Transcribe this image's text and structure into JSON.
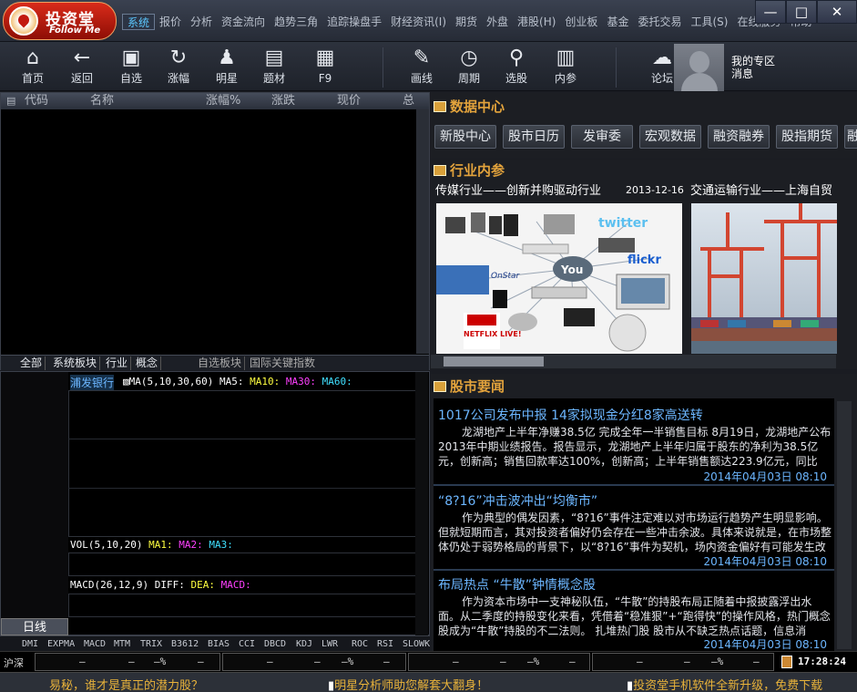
{
  "app": {
    "logo_title": "投资堂",
    "logo_sub": "Follow Me"
  },
  "menus": [
    "系统",
    "报价",
    "分析",
    "资金流向",
    "趋势三角",
    "追踪操盘手",
    "财经资讯(I)",
    "期货",
    "外盘",
    "港股(H)",
    "创业板",
    "基金",
    "委托交易",
    "工具(S)",
    "在线服务",
    "帮助"
  ],
  "window": {
    "minimize": "—",
    "maximize": "□",
    "close": "✕"
  },
  "toolbar": [
    {
      "label": "首页",
      "icon": "home-icon",
      "glyph": "⌂"
    },
    {
      "label": "返回",
      "icon": "back-arrow-icon",
      "glyph": "←"
    },
    {
      "label": "自选",
      "icon": "briefcase-icon",
      "glyph": "▣"
    },
    {
      "label": "涨幅",
      "icon": "refresh-icon",
      "glyph": "↻"
    },
    {
      "label": "明星",
      "icon": "person-icon",
      "glyph": "♟"
    },
    {
      "label": "题材",
      "icon": "stack-icon",
      "glyph": "▤"
    },
    {
      "label": "F9",
      "icon": "table-icon",
      "glyph": "▦"
    },
    {
      "label": "画线",
      "icon": "pencil-icon",
      "glyph": "✎"
    },
    {
      "label": "周期",
      "icon": "clock-icon",
      "glyph": "◷"
    },
    {
      "label": "选股",
      "icon": "search-icon",
      "glyph": "⚲"
    },
    {
      "label": "内参",
      "icon": "document-icon",
      "glyph": "▥"
    },
    {
      "label": "论坛",
      "icon": "chat-icon",
      "glyph": "☁"
    }
  ],
  "user_zone": {
    "line1": "我的专区",
    "line2": "消息"
  },
  "stock_list": {
    "columns": [
      "代码",
      "名称",
      "涨幅%",
      "涨跌",
      "现价",
      "总"
    ],
    "tabs": [
      "全部",
      "系统板块",
      "行业",
      "概念",
      "自选板块",
      "国际关键指数"
    ]
  },
  "chart": {
    "stock_name": "浦发银行",
    "ma_label": "MA(5,10,30,60)",
    "ma5": "MA5:",
    "ma10": "MA10:",
    "ma30": "MA30:",
    "ma60": "MA60:",
    "vol_label": "VOL(5,10,20)",
    "vol_ma1": "MA1:",
    "vol_ma2": "MA2:",
    "vol_ma3": "MA3:",
    "macd_label": "MACD(26,12,9)",
    "diff": "DIFF:",
    "dea": "DEA:",
    "macd": "MACD:",
    "period": "日线"
  },
  "indicators": [
    "DMI",
    "EXPMA",
    "MACD",
    "MTM",
    "TRIX",
    "B3612",
    "BIAS",
    "CCI",
    "DBCD",
    "KDJ",
    "LWR",
    "ROC",
    "RSI",
    "SLOWK"
  ],
  "data_center": {
    "title": "数据中心",
    "buttons": [
      "新股中心",
      "股市日历",
      "发审委",
      "宏观数据",
      "融资融券",
      "股指期货",
      "融"
    ]
  },
  "industry": {
    "title": "行业内参",
    "items": [
      {
        "title": "传媒行业——创新并购驱动行业",
        "date": "2013-12-16"
      },
      {
        "title": "交通运输行业——上海自贸",
        "date": ""
      }
    ],
    "image_words": [
      "twitter",
      "flickr",
      "You",
      "NETFLIX LIVE!",
      "OnStar"
    ]
  },
  "news": {
    "title": "股市要闻",
    "items": [
      {
        "title": "1017公司发布中报 14家拟现金分红8家高送转",
        "body": "龙湖地产上半年净赚38.5亿 完成全年一半销售目标      8月19日，龙湖地产公布2013年中期业绩报告。报告显示，龙湖地产上半年归属于股东的净利为38.5亿元，创新高；销售回款率达100%，创新高；上半年销售额达223.9亿元，同比",
        "date": "2014年04月03日 08:10"
      },
      {
        "title": "“8?16”冲击波冲出“均衡市”",
        "body": "作为典型的偶发因素，“8?16”事件注定难以对市场运行趋势产生明显影响。但就短期而言，其对投资者偏好仍会存在一些冲击余波。具体来说就是，在市场整体仍处于弱势格局的背景下，以“8?16”事件为契机，场内资金偏好有可能发生改",
        "date": "2014年04月03日 08:10"
      },
      {
        "title": "布局热点 “牛散”钟情概念股",
        "body": "作为资本市场中一支神秘队伍，“牛散”的持股布局正随着中报披露浮出水面。从二季度的持股变化来看，凭借着“稳准狠”+“跑得快”的操作风格，热门概念股成为“牛散”持股的不二法则。      扎堆热门股      股市从不缺乏热点话题，信息消",
        "date": "2014年04月03日 08:10"
      }
    ]
  },
  "status": {
    "market": "沪深",
    "dash": "—",
    "pct": "—%",
    "time": "17:28:24"
  },
  "marquee": [
    "易秘，谁才是真正的潜力股？",
    "明星分析师助您解套大翻身！",
    "投资堂手机软件全新升级，免费下载"
  ],
  "colors": {
    "accent": "#e3a33c",
    "link": "#6cb6ff",
    "brand_red": "#c21a10"
  }
}
